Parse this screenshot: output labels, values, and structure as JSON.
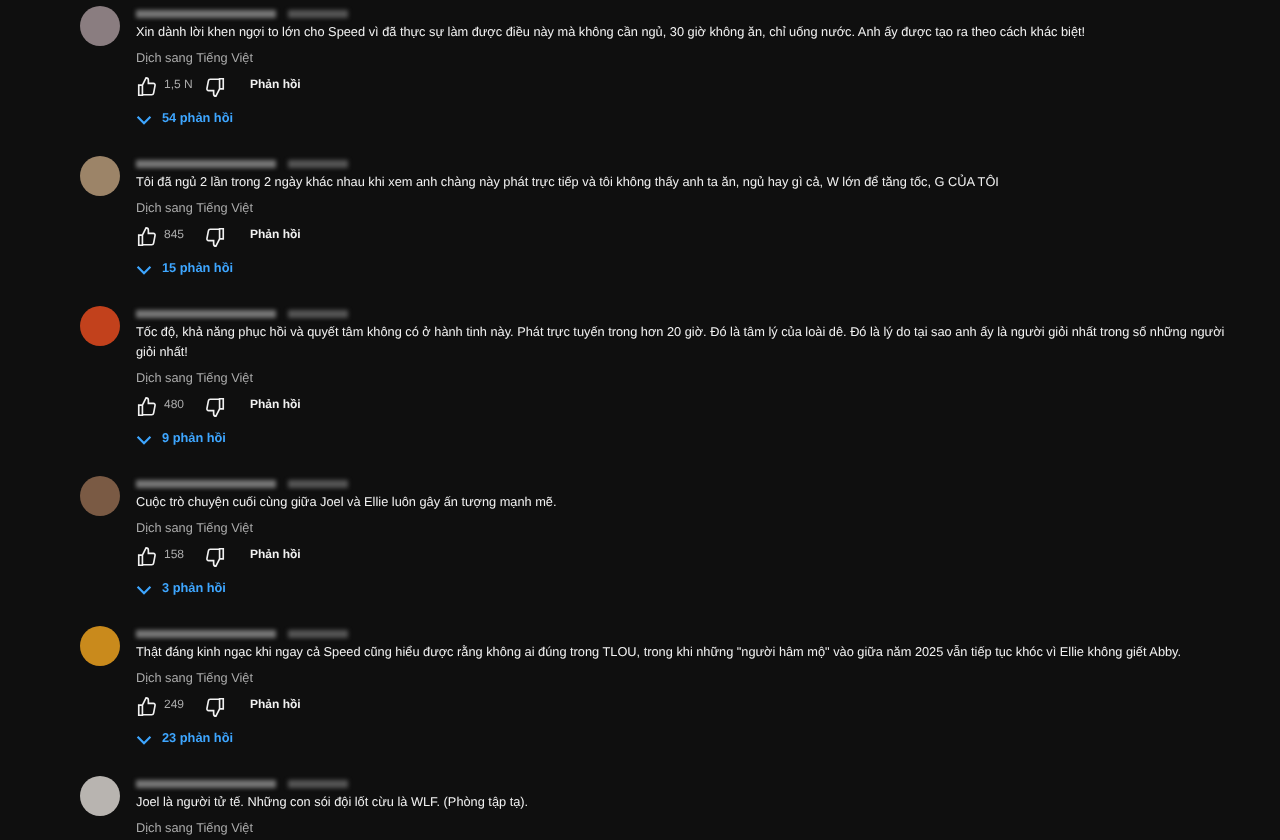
{
  "comments": [
    {
      "color": "#8a7d80",
      "text": "Xin dành lời khen ngợi to lớn cho Speed vì đã thực sự làm được điều này mà không cần ngủ, 30 giờ không ăn, chỉ uống nước. Anh ấy được tạo ra theo cách khác biệt!",
      "translate": "Dịch sang Tiếng Việt",
      "likes": "1,5 N",
      "reply_button": "Phản hồi",
      "replies": "54 phản hồi"
    },
    {
      "color": "#9c8468",
      "text": "Tôi đã ngủ 2 lần trong 2 ngày khác nhau khi xem anh chàng này phát trực tiếp và tôi không thấy anh ta ăn, ngủ hay gì cả, W lớn để tăng tốc, G CỦA TÔI",
      "translate": "Dịch sang Tiếng Việt",
      "likes": "845",
      "reply_button": "Phản hồi",
      "replies": "15 phản hồi"
    },
    {
      "color": "#c2411c",
      "text": "Tốc độ, khả năng phục hồi và quyết tâm không có ở hành tinh này. Phát trực tuyến trong hơn 20 giờ. Đó là tâm lý của loài dê. Đó là lý do tại sao anh ấy là người giỏi nhất trong số những người giỏi nhất!",
      "translate": "Dịch sang Tiếng Việt",
      "likes": "480",
      "reply_button": "Phản hồi",
      "replies": "9 phản hồi"
    },
    {
      "color": "#7a5a44",
      "text": "Cuộc trò chuyện cuối cùng giữa Joel và Ellie luôn gây ấn tượng mạnh mẽ.",
      "translate": "Dịch sang Tiếng Việt",
      "likes": "158",
      "reply_button": "Phản hồi",
      "replies": "3 phản hồi"
    },
    {
      "color": "#c98a1c",
      "text": "Thật đáng kinh ngạc khi ngay cả Speed cũng hiểu được rằng không ai đúng trong TLOU, trong khi những \"người hâm mộ\" vào giữa năm 2025 vẫn tiếp tục khóc vì Ellie không giết Abby.",
      "translate": "Dịch sang Tiếng Việt",
      "likes": "249",
      "reply_button": "Phản hồi",
      "replies": "23 phản hồi"
    },
    {
      "color": "#b8b4b0",
      "text": "Joel là người tử tế. Những con sói đội lốt cừu là WLF. (Phòng tập tạ).",
      "translate": "Dịch sang Tiếng Việt"
    }
  ]
}
